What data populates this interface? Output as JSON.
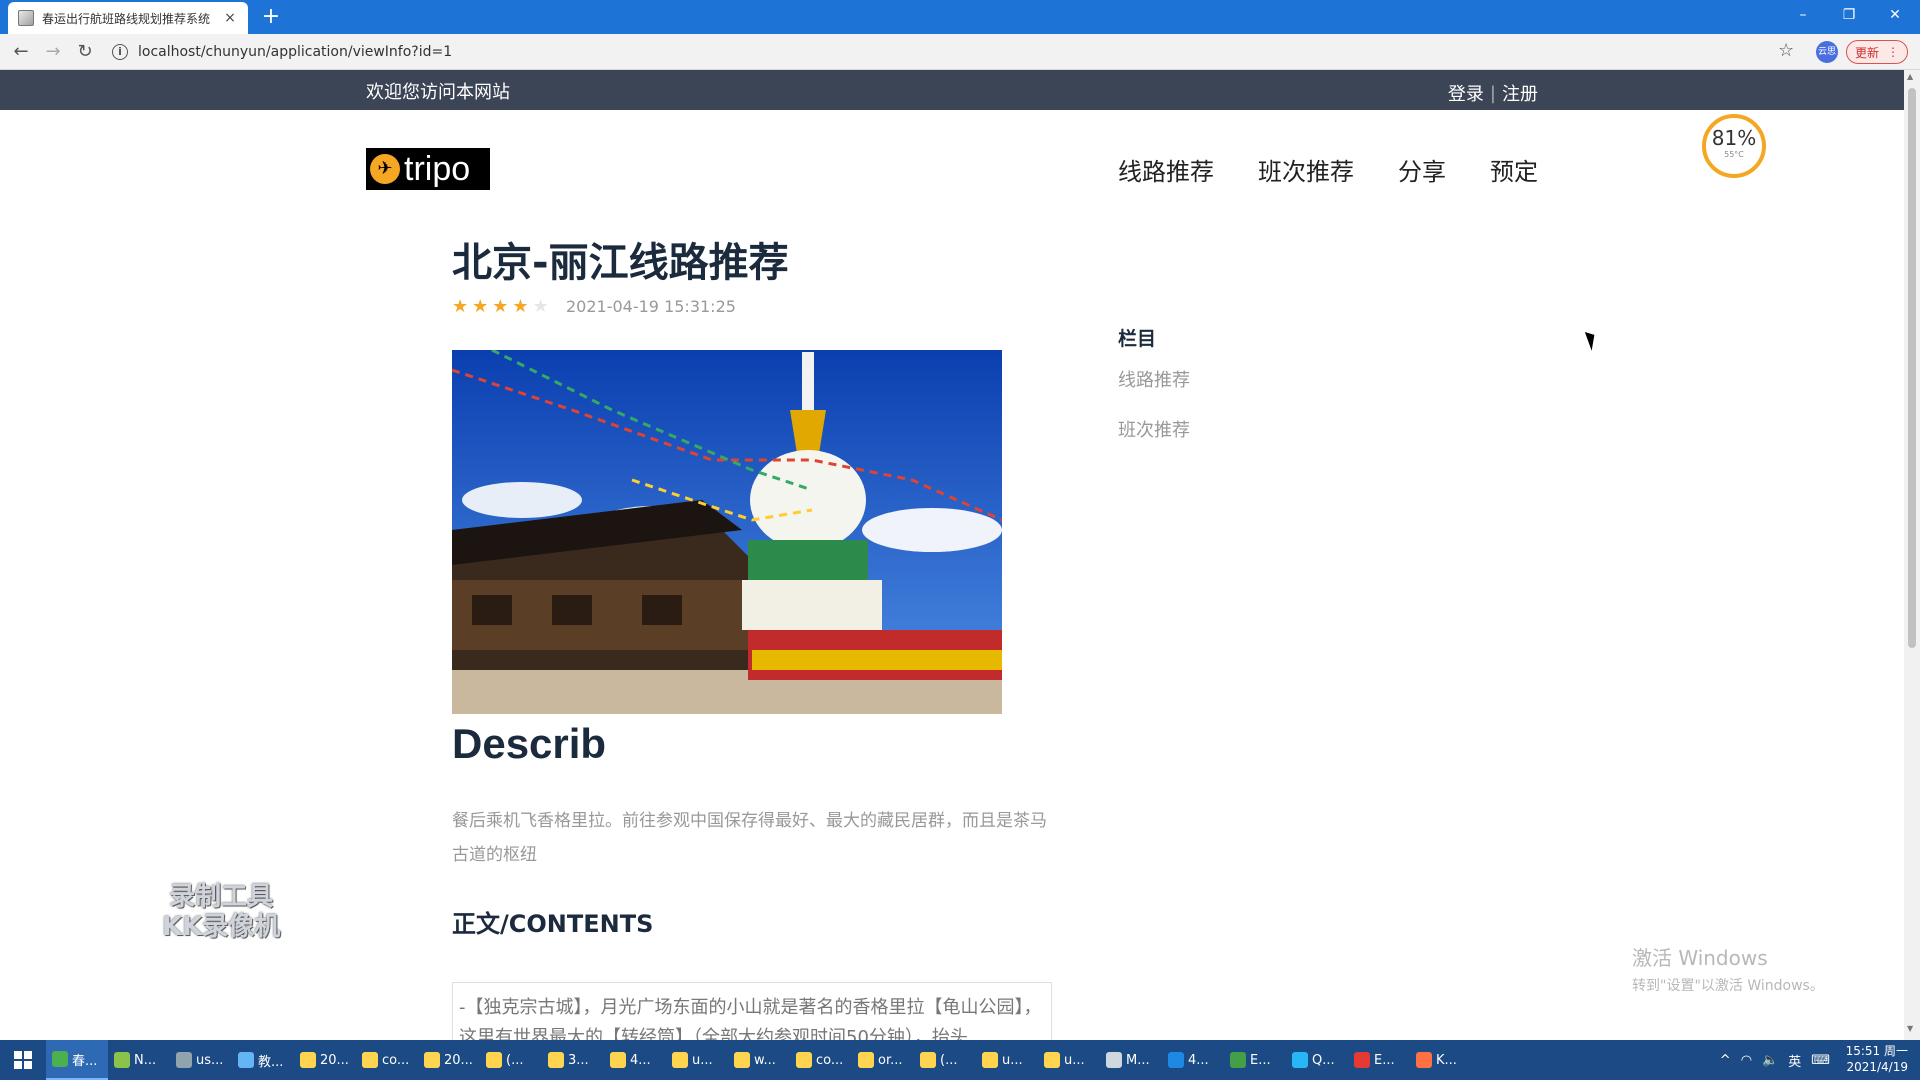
{
  "browser": {
    "tab_title": "春运出行航班路线规划推荐系统",
    "tab_close": "×",
    "new_tab": "+",
    "url": "localhost/chunyun/application/viewInfo?id=1",
    "update_label": "更新",
    "profile_label": "云思",
    "window_controls": {
      "minimize": "–",
      "restore": "❐",
      "close": "✕"
    }
  },
  "site": {
    "welcome": "欢迎您访问本网站",
    "login": "登录",
    "separator": "|",
    "register": "注册",
    "logo_text": "tripo",
    "nav": [
      "线路推荐",
      "班次推荐",
      "分享",
      "预定"
    ]
  },
  "perf_widget": {
    "value": "81%",
    "temp": "55°C"
  },
  "article": {
    "title": "北京-丽江线路推荐",
    "rating": 4,
    "rating_max": 5,
    "datetime": "2021-04-19 15:31:25",
    "describ_heading": "Describ",
    "description": "餐后乘机飞香格里拉。前往参观中国保存得最好、最大的藏民居群，而且是茶马古道的枢纽",
    "contents_heading": "正文/CONTENTS",
    "contents_text": "-【独克宗古城】，月光广场东面的小山就是著名的香格里拉【龟山公园】，这里有世界最大的【转经筒】（全部大约参观时间50分钟），抬头"
  },
  "sidebar": {
    "heading": "栏目",
    "links": [
      "线路推荐",
      "班次推荐"
    ]
  },
  "watermark": {
    "line1": "录制工具",
    "line2": "KK录像机"
  },
  "activation": {
    "title": "激活 Windows",
    "subtitle": "转到\"设置\"以激活 Windows。"
  },
  "taskbar": {
    "items": [
      "春...",
      "N...",
      "us...",
      "教...",
      "20...",
      "co...",
      "20...",
      "(...",
      "3...",
      "4...",
      "u...",
      "w...",
      "co...",
      "or...",
      "(...",
      "u...",
      "u...",
      "M...",
      "4...",
      "E...",
      "Q...",
      "E...",
      "K..."
    ],
    "ime": "英",
    "time": "15:51 周一",
    "date": "2021/4/19"
  },
  "colors": {
    "tabbar": "#1e73d6",
    "topstrip": "#3b4556",
    "accent": "#f5a623",
    "title": "#1b2a3c",
    "taskbar": "#1b4a84"
  }
}
